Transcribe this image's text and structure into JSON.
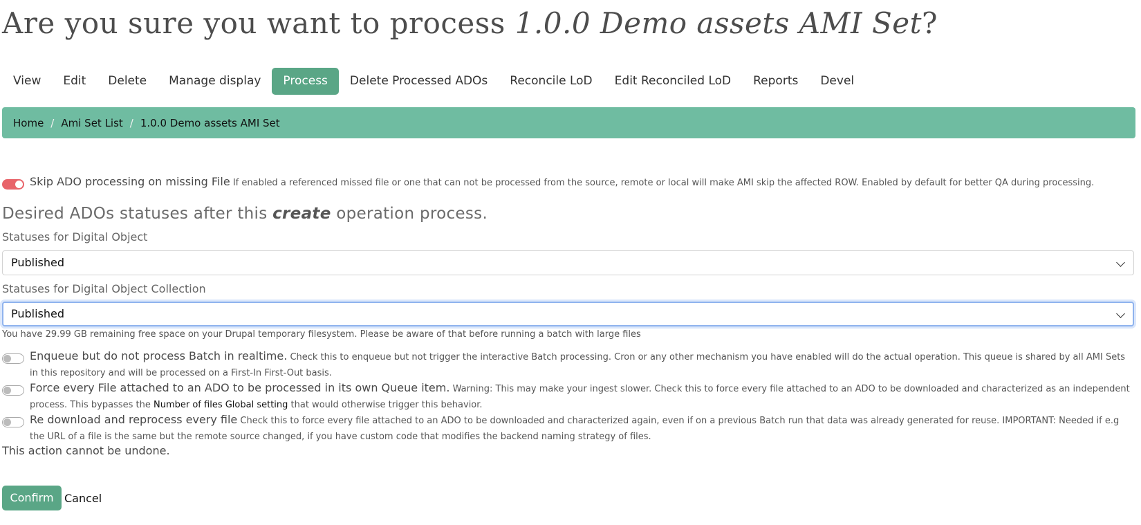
{
  "page": {
    "title_prefix": "Are you sure you want to process ",
    "title_item": "1.0.0 Demo assets AMI Set",
    "title_suffix": "?"
  },
  "tabs": [
    {
      "label": "View"
    },
    {
      "label": "Edit"
    },
    {
      "label": "Delete"
    },
    {
      "label": "Manage display"
    },
    {
      "label": "Process",
      "active": true
    },
    {
      "label": "Delete Processed ADOs"
    },
    {
      "label": "Reconcile LoD"
    },
    {
      "label": "Edit Reconciled LoD"
    },
    {
      "label": "Reports"
    },
    {
      "label": "Devel"
    }
  ],
  "breadcrumb": {
    "items": [
      "Home",
      "Ami Set List",
      "1.0.0 Demo assets AMI Set"
    ],
    "separator": "/"
  },
  "skip_missing": {
    "enabled": true,
    "label": "Skip ADO processing on missing File",
    "description": "If enabled a referenced missed file or one that can not be processed from the source, remote or local will make AMI skip the affected ROW. Enabled by default for better QA during processing."
  },
  "statuses_section": {
    "title_prefix": "Desired ADOs statuses after this ",
    "title_op": "create",
    "title_suffix": " operation process."
  },
  "digital_object": {
    "label": "Statuses for Digital Object",
    "selected": "Published"
  },
  "digital_object_collection": {
    "label": "Statuses for Digital Object Collection",
    "selected": "Published"
  },
  "disk_info": "You have 29.99 GB remaining free space on your Drupal temporary filesystem. Please be aware of that before running a batch with large files",
  "enqueue": {
    "enabled": false,
    "label": "Enqueue but do not process Batch in realtime.",
    "description": "Check this to enqueue but not trigger the interactive Batch processing. Cron or any other mechanism you have enabled will do the actual operation. This queue is shared by all AMI Sets in this repository and will be processed on a First-In First-Out basis."
  },
  "force_queue": {
    "enabled": false,
    "label": "Force every File attached to an ADO to be processed in its own Queue item.",
    "description_before": "Warning: This may make your ingest slower. Check this to force every file attached to an ADO to be downloaded and characterized as an independent process. This bypasses the ",
    "link_text": "Number of files Global setting",
    "description_after": " that would otherwise trigger this behavior."
  },
  "redownload": {
    "enabled": false,
    "label": "Re download and reprocess every file",
    "description": "Check this to force every file attached to an ADO to be downloaded and characterized again, even if on a previous Batch run that data was already generated for reuse. IMPORTANT: Needed if e.g the URL of a file is the same but the remote source changed, if you have custom code that modifies the backend naming strategy of files."
  },
  "undone_notice": "This action cannot be undone.",
  "actions": {
    "confirm_label": "Confirm",
    "cancel_label": "Cancel"
  },
  "colors": {
    "accent": "#5aa686",
    "breadcrumb_bg": "#6fbca1",
    "toggle_on": "#e8646a"
  }
}
